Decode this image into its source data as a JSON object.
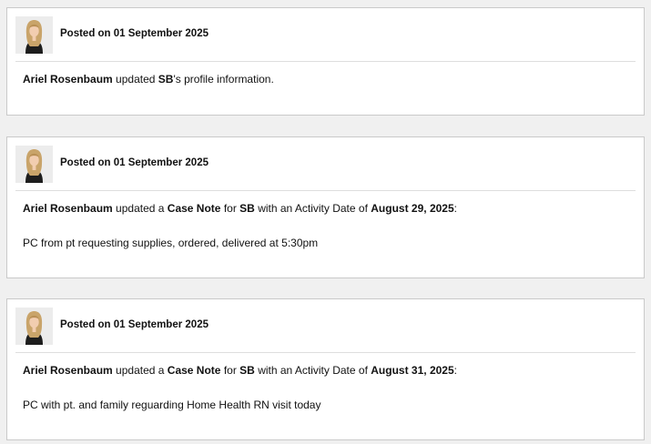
{
  "posts": [
    {
      "posted": "Posted on 01 September 2025",
      "actor": "Ariel Rosenbaum",
      "verb": "updated",
      "subject": "SB",
      "tail": "'s profile information."
    },
    {
      "posted": "Posted on 01 September 2025",
      "actor": "Ariel Rosenbaum",
      "verb": "updated a",
      "item": "Case Note",
      "for_text": "for",
      "subject": "SB",
      "mid_text": "with an Activity Date of",
      "date": "August 29, 2025",
      "colon": ":",
      "note": "PC from pt requesting supplies, ordered, delivered at 5:30pm"
    },
    {
      "posted": "Posted on 01 September 2025",
      "actor": "Ariel Rosenbaum",
      "verb": "updated a",
      "item": "Case Note",
      "for_text": "for",
      "subject": "SB",
      "mid_text": "with an Activity Date of",
      "date": "August 31, 2025",
      "colon": ":",
      "note": "PC with pt. and family reguarding Home Health RN visit today"
    }
  ]
}
